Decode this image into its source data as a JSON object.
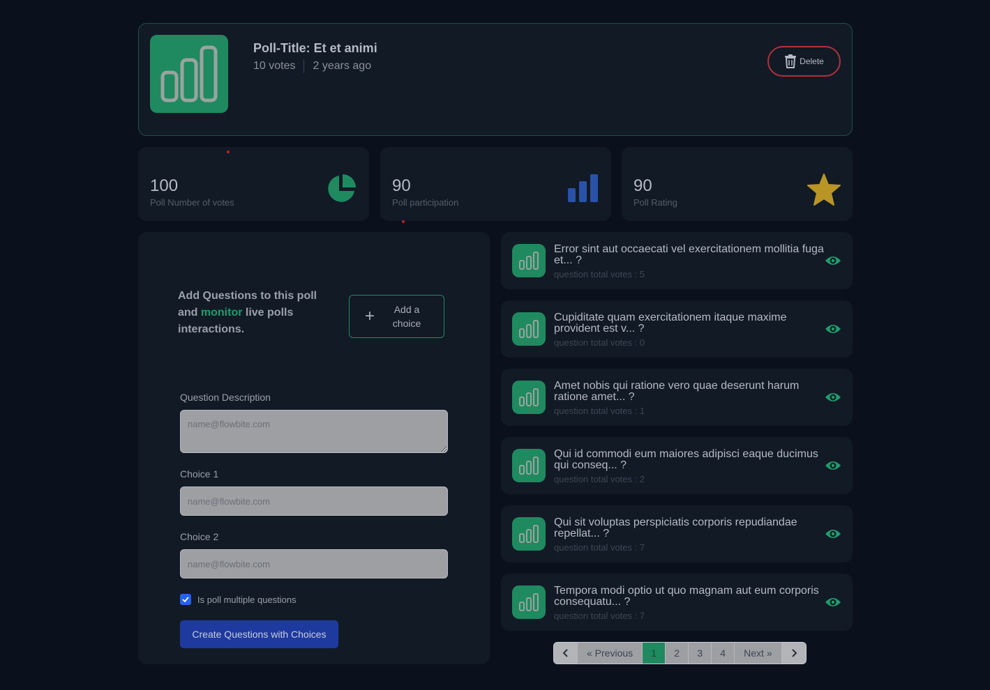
{
  "header": {
    "title": "Poll-Title: Et et animi",
    "votes": "10 votes",
    "age": "2 years ago",
    "delete_label": "Delete"
  },
  "stats": [
    {
      "value": "100",
      "label": "Poll Number of votes",
      "icon": "pie-chart-icon",
      "color": "#1f8a5f"
    },
    {
      "value": "90",
      "label": "Poll participation",
      "icon": "bar-chart-icon",
      "color": "#2952a8"
    },
    {
      "value": "90",
      "label": "Poll Rating",
      "icon": "star-icon",
      "color": "#b89525"
    }
  ],
  "form": {
    "promo_part1": "Add Questions to this poll and ",
    "promo_accent": "monitor",
    "promo_part2": " live polls interactions.",
    "add_choice_label": "Add a choice",
    "question_label": "Question Description",
    "question_placeholder": "name@flowbite.com",
    "choice1_label": "Choice 1",
    "choice1_placeholder": "name@flowbite.com",
    "choice2_label": "Choice 2",
    "choice2_placeholder": "name@flowbite.com",
    "multiple_label": "Is poll multiple questions",
    "multiple_checked": true,
    "submit_label": "Create Questions with Choices"
  },
  "questions": [
    {
      "text": "Error sint aut occaecati vel exercitationem mollitia fuga et... ?",
      "votes": "question total votes : 5"
    },
    {
      "text": "Cupiditate quam exercitationem itaque maxime provident est v... ?",
      "votes": "question total votes : 0"
    },
    {
      "text": "Amet nobis qui ratione vero quae deserunt harum ratione amet... ?",
      "votes": "question total votes : 1"
    },
    {
      "text": "Qui id commodi eum maiores adipisci eaque ducimus qui conseq... ?",
      "votes": "question total votes : 2"
    },
    {
      "text": "Qui sit voluptas perspiciatis corporis repudiandae repellat... ?",
      "votes": "question total votes : 7"
    },
    {
      "text": "Tempora modi optio ut quo magnam aut eum corporis consequatu... ?",
      "votes": "question total votes : 7"
    }
  ],
  "pagination": {
    "previous": "« Previous",
    "next": "Next »",
    "pages": [
      "1",
      "2",
      "3",
      "4"
    ],
    "current": "1"
  },
  "colors": {
    "accent": "#1f8a5f",
    "danger": "#b0323a",
    "primary": "#1e3a9e"
  }
}
